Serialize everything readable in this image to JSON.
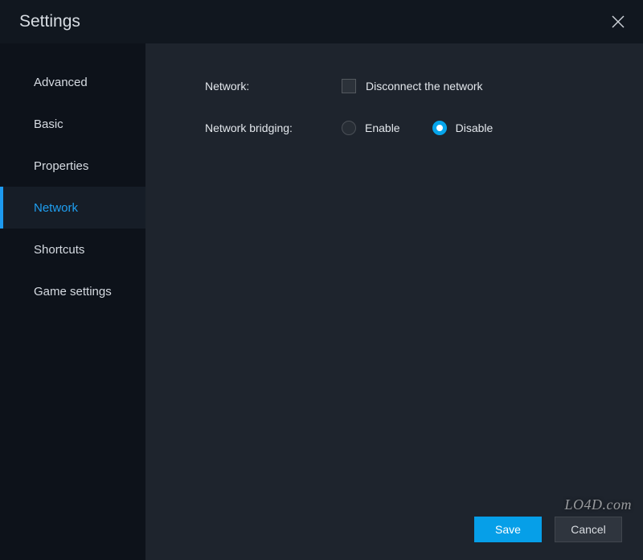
{
  "window": {
    "title": "Settings"
  },
  "sidebar": {
    "items": [
      {
        "label": "Advanced",
        "active": false
      },
      {
        "label": "Basic",
        "active": false
      },
      {
        "label": "Properties",
        "active": false
      },
      {
        "label": "Network",
        "active": true
      },
      {
        "label": "Shortcuts",
        "active": false
      },
      {
        "label": "Game settings",
        "active": false
      }
    ]
  },
  "form": {
    "network": {
      "label": "Network:",
      "checkbox_label": "Disconnect the network",
      "checked": false
    },
    "bridging": {
      "label": "Network bridging:",
      "options": {
        "enable": "Enable",
        "disable": "Disable"
      },
      "selected": "disable"
    }
  },
  "buttons": {
    "save": "Save",
    "cancel": "Cancel"
  },
  "watermark": "LO4D.com"
}
